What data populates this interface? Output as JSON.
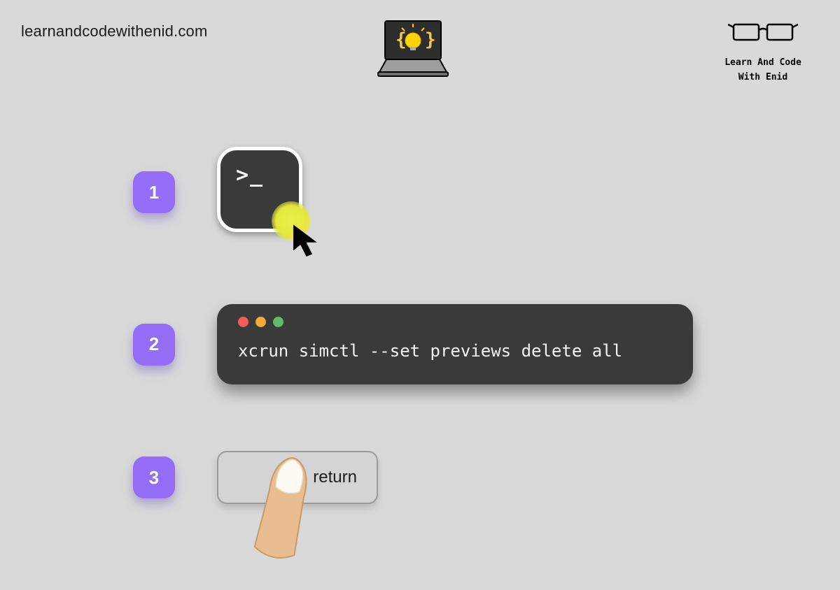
{
  "header": {
    "site_url": "learnandcodewithenid.com",
    "brand_line1": "Learn And Code",
    "brand_line2": "With Enid"
  },
  "steps": {
    "one": {
      "number": "1"
    },
    "two": {
      "number": "2",
      "command": "xcrun simctl --set previews delete all"
    },
    "three": {
      "number": "3",
      "key_label": "return"
    }
  },
  "colors": {
    "accent": "#946df6",
    "terminal_bg": "#3a3a3a",
    "page_bg": "#d9d9d9"
  }
}
